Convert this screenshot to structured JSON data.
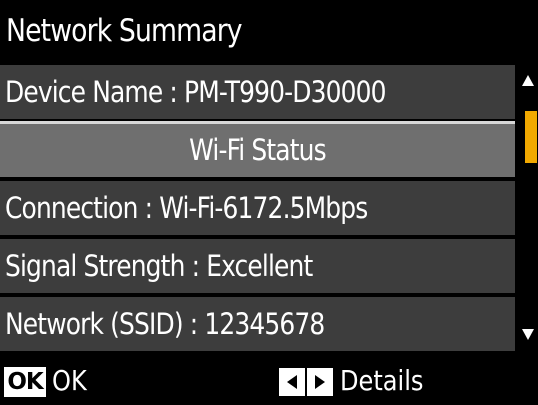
{
  "header": {
    "title": "Network Summary"
  },
  "rows": [
    {
      "text": "Device Name : PM-T990-D30000"
    },
    {
      "text": "Wi-Fi Status"
    },
    {
      "text": "Connection : Wi-Fi-6172.5Mbps"
    },
    {
      "text": "Signal Strength : Excellent"
    },
    {
      "text": "Network (SSID) : 12345678"
    }
  ],
  "scrollbar": {
    "thumb_color": "#f2a900",
    "up_icon": "triangle-up-icon",
    "down_icon": "triangle-down-icon"
  },
  "footer": {
    "ok_key": "OK",
    "ok_label": "OK",
    "left_key_icon": "left-arrow-key-icon",
    "right_key_icon": "right-arrow-key-icon",
    "details_label": "Details"
  },
  "colors": {
    "row_background": "#3d3d3d",
    "highlight_background": "#6f6f6f",
    "screen_background": "#000000",
    "text": "#ffffff"
  }
}
